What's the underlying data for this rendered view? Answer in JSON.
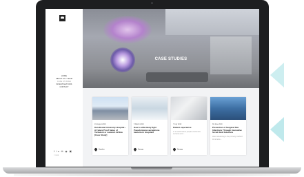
{
  "colors": {
    "accent_chevron": "#cdeef0",
    "laptop_body": "#1d1e20",
    "hero_title": "#ffffff"
  },
  "hero": {
    "title": "CASE STUDIES"
  },
  "sidebar": {
    "nav": [
      "HOME",
      "ABOUT US / TEAM",
      "CASE STUDIES",
      "INVESTIGATIONS",
      "CONTACT"
    ],
    "social_icons": "f in ✉ ◉ ▣",
    "copyright": "© 2019"
  },
  "cards": [
    {
      "date": "19 August 2019",
      "title": "Karolinska University Hospital – A Future Proof Setup of Turbulent or Laminar Airflow [Case Study]",
      "excerpt": "",
      "meta": "Sweden"
    },
    {
      "date": "5 March 2019",
      "title": "How to effectively fight Pseudomonas aeruginosa bacteria in hospitals",
      "excerpt": "",
      "meta": "Norway"
    },
    {
      "date": "7 July 2019",
      "title": "Patient experience",
      "excerpt": "In a world where people customize services and...",
      "meta": "Norway"
    },
    {
      "date": "30 June 2019",
      "title": "Prevention of Surgical Site Infections Through Innovative Scrub Sink Solutions",
      "excerpt": "Hand cleansing is the primary method to remove...",
      "meta": ""
    }
  ]
}
